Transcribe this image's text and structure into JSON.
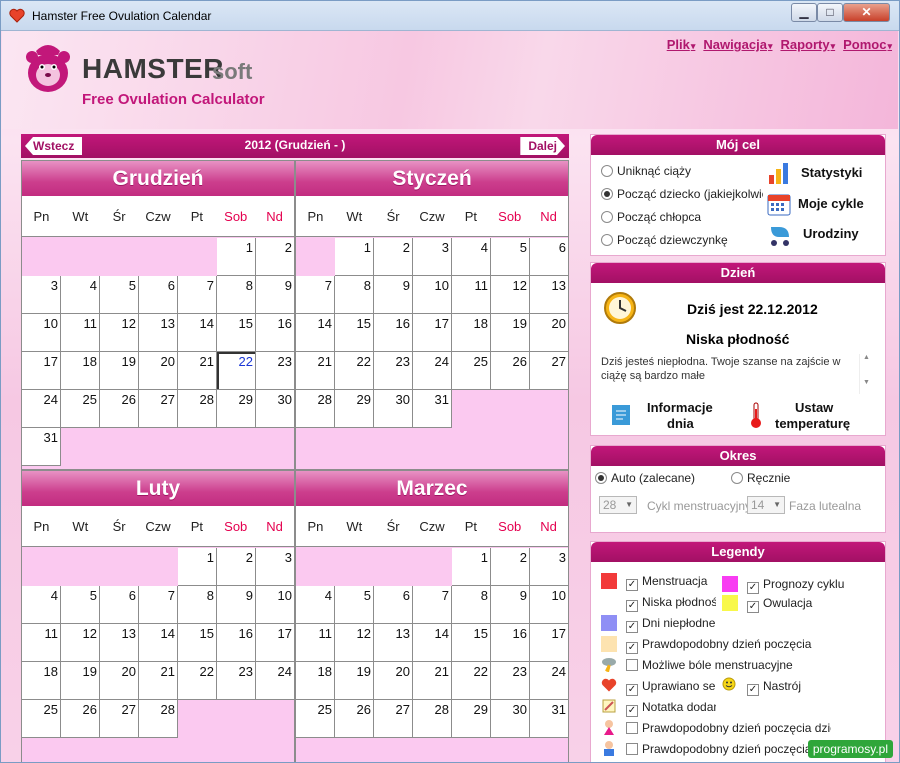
{
  "window": {
    "title": "Hamster Free Ovulation Calendar",
    "min": "▁",
    "max": "□",
    "close": "✕"
  },
  "brand": {
    "name1": "HAMSTER",
    "name2": "soft",
    "tagline": "Free Ovulation Calculator"
  },
  "menu": [
    "Plik",
    "Nawigacja",
    "Raporty",
    "Pomoc"
  ],
  "nav": {
    "prev": "Wstecz",
    "next": "Dalej",
    "title": "2012 (Grudzień - )"
  },
  "weekdays": [
    "Pn",
    "Wt",
    "Śr",
    "Czw",
    "Pt",
    "Sob",
    "Nd"
  ],
  "months": [
    {
      "name": "Grudzień",
      "offset": 5,
      "days": 31,
      "today": 22
    },
    {
      "name": "Styczeń",
      "offset": 1,
      "days": 31
    },
    {
      "name": "Luty",
      "offset": 4,
      "days": 28
    },
    {
      "name": "Marzec",
      "offset": 4,
      "days": 31
    }
  ],
  "goal": {
    "title": "Mój cel",
    "options": [
      "Uniknąć ciąży",
      "Począć dziecko (jakiejkolwiek",
      "Począć chłopca",
      "Począć dziewczynkę"
    ],
    "selected": 1,
    "buttons": [
      "Statystyki",
      "Moje cykle",
      "Urodziny"
    ]
  },
  "day": {
    "title": "Dzień",
    "today": "Dziś jest 22.12.2012",
    "fertility": "Niska płodność",
    "description": "Dziś jesteś niepłodna. Twoje szanse na zajście w ciążę są bardzo małe",
    "info_btn1": "Informacje",
    "info_btn2": "dnia",
    "temp_btn1": "Ustaw",
    "temp_btn2": "temperaturę"
  },
  "period": {
    "title": "Okres",
    "auto": "Auto (zalecane)",
    "manual": "Ręcznie",
    "cycle_value": "28",
    "cycle_label": "Cykl menstruacyjny",
    "luteal_value": "14",
    "luteal_label": "Faza lutealna"
  },
  "legend": {
    "title": "Legendy",
    "items": [
      {
        "label": "Menstruacja",
        "checked": true,
        "color": "#f23a3a"
      },
      {
        "label": "Niska płodność",
        "checked": true,
        "color": "#ffffff"
      },
      {
        "label": "Dni niepłodne",
        "checked": true,
        "color": "#8f8ff5"
      },
      {
        "label": "Prawdopodobny dzień poczęcia",
        "checked": true,
        "color": "#fde3b0"
      },
      {
        "label": "Możliwe bóle menstruacyjne",
        "checked": false,
        "icon": "storm-icon"
      },
      {
        "label": "Uprawiano seks",
        "checked": true,
        "icon": "heart-icon"
      },
      {
        "label": "Notatka dodana",
        "checked": true,
        "icon": "note-icon"
      },
      {
        "label": "Prawdopodobny dzień poczęcia dziewczynki",
        "checked": false,
        "icon": "girl-icon"
      },
      {
        "label": "Prawdopodobny dzień poczęcia chłopca",
        "checked": false,
        "icon": "boy-icon"
      }
    ],
    "right_items": [
      {
        "label": "Prognozy cyklu",
        "checked": true,
        "color": "#f83cf2"
      },
      {
        "label": "Owulacja",
        "checked": true,
        "color": "#f8f84a"
      },
      {
        "label": "Nastrój",
        "checked": true,
        "icon": "smile-icon"
      }
    ]
  },
  "watermark": "programosy.pl"
}
